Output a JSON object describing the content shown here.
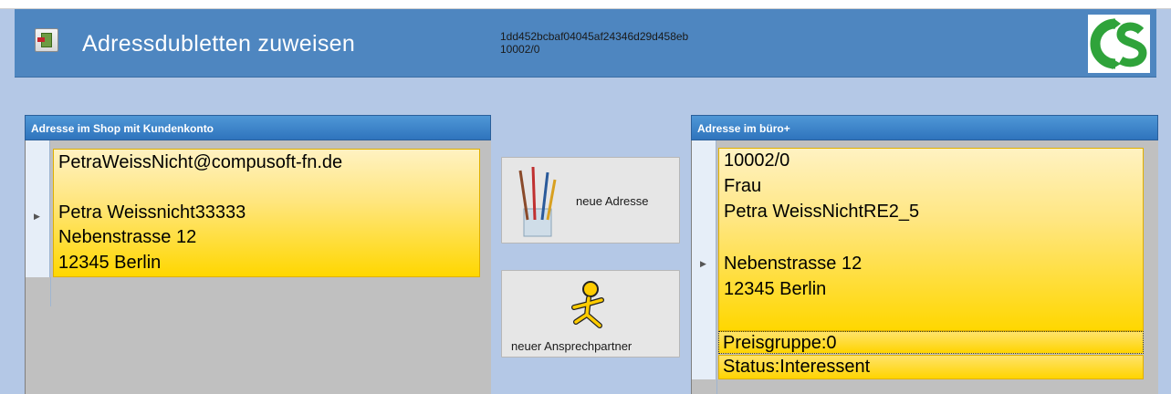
{
  "header": {
    "title": "Adressdubletten zuweisen",
    "id_hash": "1dd452bcbaf04045af24346d29d458eb",
    "id_number": "10002/0",
    "logo_icon": "cs-logo-icon",
    "app_icon": "exit-door-icon"
  },
  "left_panel": {
    "title": "Adresse im Shop mit Kundenkonto",
    "lines": [
      "PetraWeissNicht@compusoft-fn.de",
      "",
      "Petra Weissnicht33333",
      "Nebenstrasse 12",
      "12345 Berlin"
    ]
  },
  "buttons": {
    "new_address": "neue Adresse",
    "new_contact": "neuer Ansprechpartner",
    "new_address_icon": "paintbrush-icon",
    "new_contact_icon": "running-man-icon"
  },
  "right_panel": {
    "title": "Adresse im büro+",
    "lines": [
      "10002/0",
      "Frau",
      "Petra WeissNichtRE2_5",
      "",
      "Nebenstrasse 12",
      "12345 Berlin",
      ""
    ],
    "price_group": "Preisgruppe:0",
    "status": "Status:Interessent"
  },
  "colors": {
    "header_bg": "#4e86c0",
    "panel_head": "#2f74bd",
    "cell_yellow": "#ffd700",
    "logo_green": "#2fa33a"
  }
}
